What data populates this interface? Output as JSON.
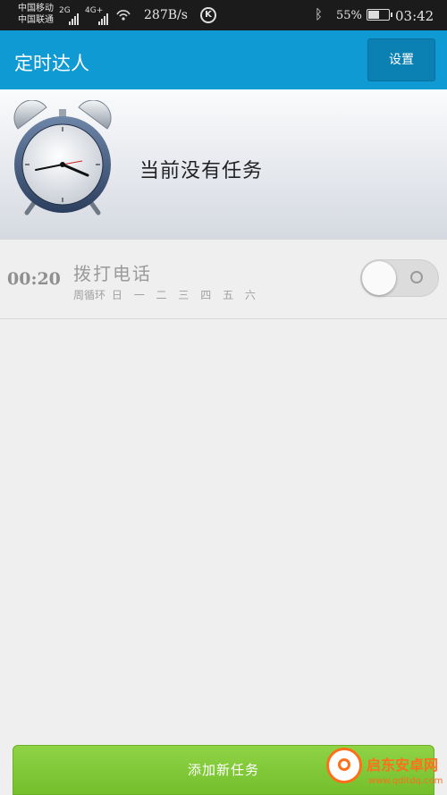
{
  "status_bar": {
    "carrier1": "中国移动",
    "carrier2": "中国联通",
    "net1": "2G",
    "net2": "4G+",
    "speed": "287B/s",
    "k_icon": "K",
    "bluetooth_icon": "bluetooth-icon",
    "battery_percent": "55%",
    "battery_level": 0.55,
    "time": "03:42"
  },
  "app": {
    "title": "定时达人",
    "settings_label": "设置",
    "accent": "#0f9ad3"
  },
  "banner": {
    "icon": "alarm-clock-icon",
    "text": "当前没有任务"
  },
  "tasks": [
    {
      "time": "00:20",
      "name": "拨打电话",
      "repeat_label": "周循环",
      "days": [
        "日",
        "一",
        "二",
        "三",
        "四",
        "五",
        "六"
      ],
      "enabled": false
    }
  ],
  "add_button": {
    "label": "添加新任务",
    "color": "#7cc636"
  },
  "watermark": {
    "title": "启东安卓网",
    "url": "www.qdltdq.com"
  }
}
